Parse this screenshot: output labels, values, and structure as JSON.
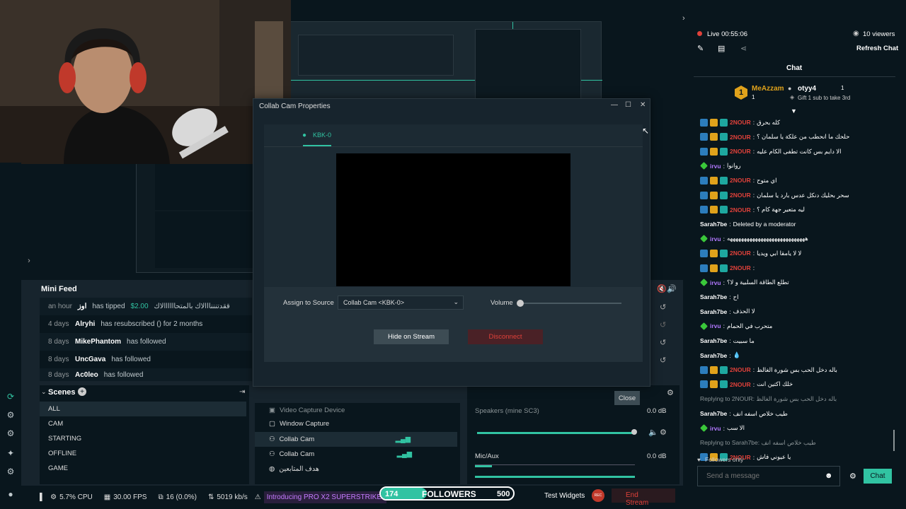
{
  "window": {
    "minimize": "—",
    "maximize": "☐",
    "close": "✕"
  },
  "mini_feed": {
    "title": "Mini Feed",
    "rows": [
      {
        "time": "an hour",
        "name": "اوز",
        "action": "has tipped",
        "amount": "$2.00",
        "note": "ققدتنننااالاك بالمتحاااااالاك"
      },
      {
        "time": "4 days",
        "name": "Alryhi",
        "action": "has resubscribed () for 2 months"
      },
      {
        "time": "8 days",
        "name": "MikePhantom",
        "action": "has followed"
      },
      {
        "time": "8 days",
        "name": "UncGava",
        "action": "has followed"
      },
      {
        "time": "8 days",
        "name": "Ac0leo",
        "action": "has followed"
      }
    ]
  },
  "scenes": {
    "title": "Scenes",
    "items": [
      "ALL",
      "CAM",
      "STARTING",
      "OFFLINE",
      "GAME"
    ]
  },
  "sources": {
    "items": [
      "Video Capture Device",
      "Window Capture",
      "Collab Cam",
      "Collab Cam",
      "هدف المتابعين"
    ]
  },
  "mixer": {
    "items": [
      {
        "name": "Speakers (mine SC3)",
        "db": "0.0 dB"
      },
      {
        "name": "Mic/Aux",
        "db": "0.0 dB"
      }
    ]
  },
  "footer": {
    "cpu": "5.7% CPU",
    "fps": "30.00 FPS",
    "dropped": "16 (0.0%)",
    "bitrate": "5019 kb/s",
    "promo": "Introducing PRO X2 SUPERSTRIKE.",
    "followers_current": "174",
    "followers_label": "FOLLOWERS",
    "followers_goal": "500",
    "followers_progress": 0.348,
    "test_widgets": "Test Widgets",
    "rec": "REC",
    "end_stream": "End Stream"
  },
  "dialog": {
    "title": "Collab Cam Properties",
    "tab": "KBK-0",
    "assign_label": "Assign to Source",
    "assign_value": "Collab Cam <KBK-0>",
    "volume_label": "Volume",
    "hide_button": "Hide on Stream",
    "disconnect_button": "Disconnect",
    "close_button": "Close"
  },
  "chat": {
    "live": "Live 00:55:06",
    "viewers": "10 viewers",
    "refresh": "Refresh Chat",
    "title": "Chat",
    "top_gifter_name": "MeAzzam",
    "top_gifter_rank": "1",
    "top_gifter_count": "1",
    "second_name": "otyy4",
    "second_count": "1",
    "second_note": "Gift 1 sub to take 3rd",
    "followers_only": "Followers only",
    "input_placeholder": "Send a message",
    "send_button": "Chat",
    "messages": [
      {
        "user": "2NOUR",
        "cls": "u-red",
        "badges": "full",
        "text": "كله بحرق"
      },
      {
        "user": "2NOUR",
        "cls": "u-red",
        "badges": "full",
        "text": "حلحك ما انحطب من علكة يا سلمان ؟"
      },
      {
        "user": "2NOUR",
        "cls": "u-red",
        "badges": "full",
        "text": "الا دايم بس كانت تطفى الكام عليه"
      },
      {
        "user": "irvu",
        "cls": "u-purple",
        "badges": "green",
        "text": "روانوا"
      },
      {
        "user": "2NOUR",
        "cls": "u-red",
        "badges": "full",
        "text": "اي متوح"
      },
      {
        "user": "2NOUR",
        "cls": "u-red",
        "badges": "full",
        "text": "سحر بحليك دنكل عدس بارد يا سلمان"
      },
      {
        "user": "2NOUR",
        "cls": "u-red",
        "badges": "full",
        "text": "ليه متعير جهة كام ؟"
      },
      {
        "user": "Sarah7be",
        "cls": "u-white",
        "badges": "none",
        "text": "Deleted by a moderator"
      },
      {
        "user": "irvu",
        "cls": "u-purple",
        "badges": "green",
        "text": "ههههههههههههههههههههههههههههه"
      },
      {
        "user": "2NOUR",
        "cls": "u-red",
        "badges": "full",
        "text": "لا لا يامقا ابي ويديا"
      },
      {
        "user": "2NOUR",
        "cls": "u-red",
        "badges": "full",
        "text": ""
      },
      {
        "user": "irvu",
        "cls": "u-purple",
        "badges": "green",
        "text": "تطلع الطاقة السلبية و لا؟"
      },
      {
        "user": "Sarah7be",
        "cls": "u-white",
        "badges": "none",
        "text": "اح"
      },
      {
        "user": "Sarah7be",
        "cls": "u-white",
        "badges": "none",
        "text": "لا الحذف"
      },
      {
        "user": "irvu",
        "cls": "u-purple",
        "badges": "green",
        "text": "متحرب في الحمام"
      },
      {
        "user": "Sarah7be",
        "cls": "u-white",
        "badges": "none",
        "text": "ما سبيت"
      },
      {
        "user": "Sarah7be",
        "cls": "u-white",
        "badges": "none",
        "text": "💧"
      },
      {
        "user": "2NOUR",
        "cls": "u-red",
        "badges": "full",
        "text": "باله دخل الحب بس شورة الغالظ"
      },
      {
        "user": "2NOUR",
        "cls": "u-red",
        "badges": "full",
        "text": "خلك اكتين انت"
      },
      {
        "reply": "Replying to 2NOUR: باله دخل الحب بس شورة الغالظ"
      },
      {
        "user": "Sarah7be",
        "cls": "u-white",
        "badges": "none",
        "text": "طيب خلاص اسفه انف"
      },
      {
        "user": "irvu",
        "cls": "u-purple",
        "badges": "green",
        "text": "الا سب"
      },
      {
        "reply": "Replying to Sarah7be: طيب خلاص اسفه انف"
      },
      {
        "user": "2NOUR",
        "cls": "u-red",
        "badges": "full",
        "text": "يا عيوني فاش"
      }
    ]
  },
  "preview": {
    "mini_feed_title": "Mini Feed",
    "scenes_title": "Scenes"
  }
}
